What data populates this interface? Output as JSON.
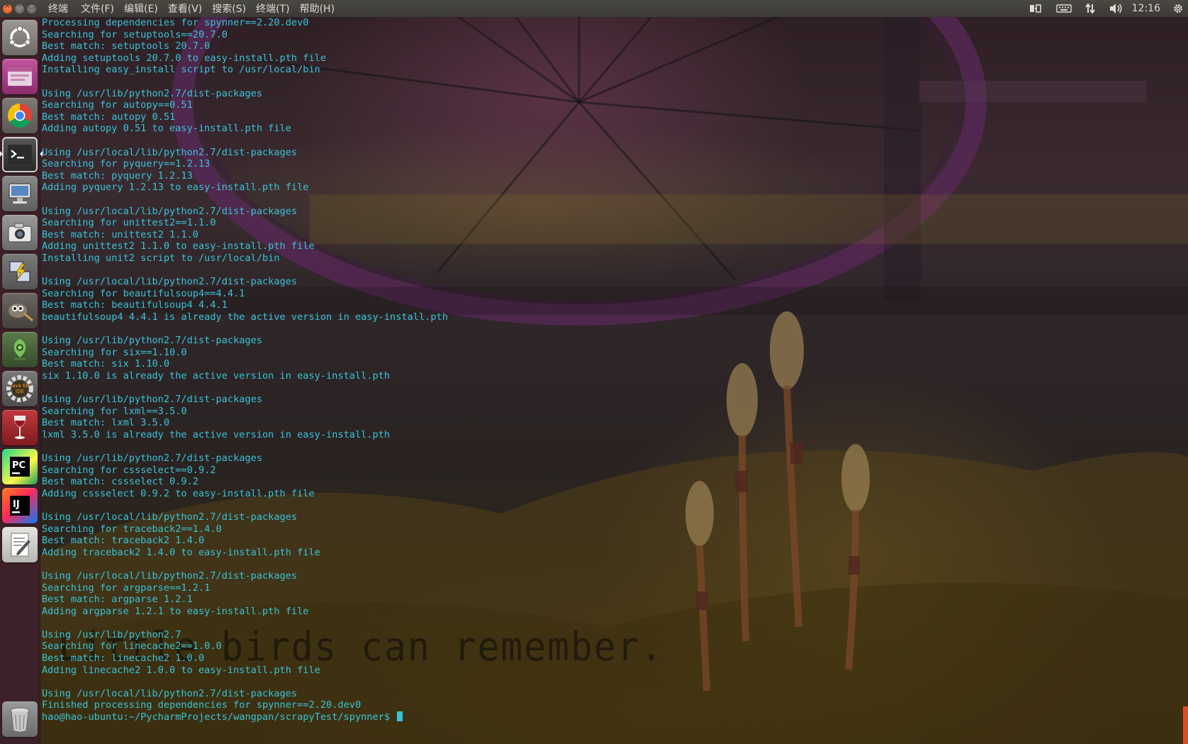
{
  "window_controls": {
    "close": "×",
    "minimize": "–",
    "maximize": "□"
  },
  "menubar": {
    "items": [
      "终端",
      "文件(F)",
      "编辑(E)",
      "查看(V)",
      "搜索(S)",
      "终端(T)",
      "帮助(H)"
    ]
  },
  "tray": {
    "icons": [
      "transfer-icon",
      "keyboard-icon",
      "network-icon",
      "volume-icon",
      "settings-gear-icon"
    ],
    "clock": "12:16"
  },
  "launcher": {
    "items": [
      {
        "name": "dash-home",
        "icon": "ubuntu-logo-icon",
        "color": "#8f8a86"
      },
      {
        "name": "files",
        "icon": "files-icon",
        "color": "#b23e8b"
      },
      {
        "name": "chrome",
        "icon": "chrome-icon",
        "color": "#6e6a66"
      },
      {
        "name": "terminal",
        "icon": "terminal-icon",
        "color": "#3a3a3a"
      },
      {
        "name": "remote-desktop",
        "icon": "monitor-icon",
        "color": "#7d7d7d"
      },
      {
        "name": "screenshot",
        "icon": "camera-icon",
        "color": "#8a8a8a"
      },
      {
        "name": "network-tool",
        "icon": "network-transfer-icon",
        "color": "#6d6d6d"
      },
      {
        "name": "gimp",
        "icon": "gimp-icon",
        "color": "#5e5a55"
      },
      {
        "name": "android-studio",
        "icon": "android-icon",
        "color": "#4a6a3c"
      },
      {
        "name": "eclipse-javaee",
        "icon": "gear-icon",
        "color": "#6b6b6b"
      },
      {
        "name": "wine",
        "icon": "wine-glass-icon",
        "color": "#b02a30"
      },
      {
        "name": "pycharm",
        "icon": "pycharm-icon",
        "color": "#2f9c4f"
      },
      {
        "name": "intellij",
        "icon": "intellij-icon",
        "color": "#4a3a9e"
      },
      {
        "name": "text-editor",
        "icon": "text-editor-icon",
        "color": "#d8d6d2"
      },
      {
        "name": "trash",
        "icon": "trash-icon",
        "color": "#7a7a7a"
      }
    ],
    "java_ee_label": "Java EE IDE",
    "pycharm_label": "PC",
    "intellij_label": "IJ"
  },
  "terminal": {
    "lines": [
      "Processing dependencies for spynner==2.20.dev0",
      "Searching for setuptools==20.7.0",
      "Best match: setuptools 20.7.0",
      "Adding setuptools 20.7.0 to easy-install.pth file",
      "Installing easy_install script to /usr/local/bin",
      "",
      "Using /usr/lib/python2.7/dist-packages",
      "Searching for autopy==0.51",
      "Best match: autopy 0.51",
      "Adding autopy 0.51 to easy-install.pth file",
      "",
      "Using /usr/local/lib/python2.7/dist-packages",
      "Searching for pyquery==1.2.13",
      "Best match: pyquery 1.2.13",
      "Adding pyquery 1.2.13 to easy-install.pth file",
      "",
      "Using /usr/local/lib/python2.7/dist-packages",
      "Searching for unittest2==1.1.0",
      "Best match: unittest2 1.1.0",
      "Adding unittest2 1.1.0 to easy-install.pth file",
      "Installing unit2 script to /usr/local/bin",
      "",
      "Using /usr/local/lib/python2.7/dist-packages",
      "Searching for beautifulsoup4==4.4.1",
      "Best match: beautifulsoup4 4.4.1",
      "beautifulsoup4 4.4.1 is already the active version in easy-install.pth",
      "",
      "Using /usr/lib/python2.7/dist-packages",
      "Searching for six==1.10.0",
      "Best match: six 1.10.0",
      "six 1.10.0 is already the active version in easy-install.pth",
      "",
      "Using /usr/lib/python2.7/dist-packages",
      "Searching for lxml==3.5.0",
      "Best match: lxml 3.5.0",
      "lxml 3.5.0 is already the active version in easy-install.pth",
      "",
      "Using /usr/lib/python2.7/dist-packages",
      "Searching for cssselect==0.9.2",
      "Best match: cssselect 0.9.2",
      "Adding cssselect 0.9.2 to easy-install.pth file",
      "",
      "Using /usr/local/lib/python2.7/dist-packages",
      "Searching for traceback2==1.4.0",
      "Best match: traceback2 1.4.0",
      "Adding traceback2 1.4.0 to easy-install.pth file",
      "",
      "Using /usr/local/lib/python2.7/dist-packages",
      "Searching for argparse==1.2.1",
      "Best match: argparse 1.2.1",
      "Adding argparse 1.2.1 to easy-install.pth file",
      "",
      "Using /usr/lib/python2.7",
      "Searching for linecache2==1.0.0",
      "Best match: linecache2 1.0.0",
      "Adding linecache2 1.0.0 to easy-install.pth file",
      "",
      "Using /usr/local/lib/python2.7/dist-packages",
      "Finished processing dependencies for spynner==2.20.dev0"
    ],
    "prompt": "hao@hao-ubuntu:~/PycharmProjects/wangpan/scrapyTest/spynner$ ",
    "text_color": "#39c3d8"
  },
  "wallpaper": {
    "caption": "Little birds can remember."
  }
}
